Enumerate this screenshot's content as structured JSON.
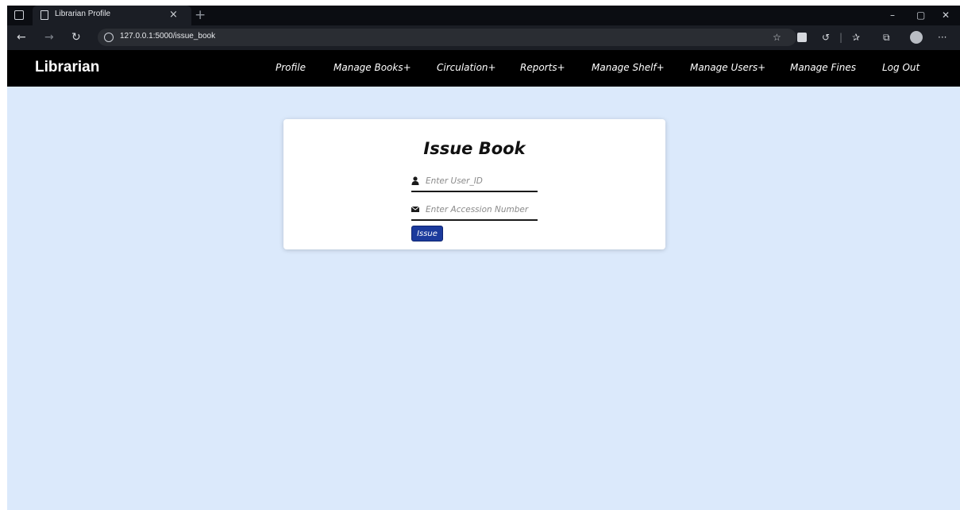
{
  "browser": {
    "tab_title": "Librarian Profile",
    "tab_close": "×",
    "new_tab": "+",
    "url": "127.0.0.1:5000/issue_book",
    "controls": {
      "minimize": "–",
      "maximize": "▢",
      "close": "✕"
    },
    "toolbar_icons": [
      "favorites-star-icon",
      "extension-icon",
      "refresh-icon",
      "favorites-icon",
      "collections-icon",
      "profile-avatar-icon",
      "more-menu-icon"
    ],
    "more": "···"
  },
  "navbar": {
    "brand": "Librarian",
    "links": [
      "Profile",
      "Manage Books+",
      "Circulation+",
      "Reports+",
      "Manage Shelf+",
      "Manage Users+",
      "Manage Fines",
      "Log Out"
    ]
  },
  "form": {
    "title": "Issue Book",
    "user_id_placeholder": "Enter User_ID",
    "accession_placeholder": "Enter Accession Number",
    "submit_label": "Issue"
  },
  "colors": {
    "page_background": "#dbe9fb",
    "navbar": "#000000",
    "button": "#1b3a9c"
  }
}
